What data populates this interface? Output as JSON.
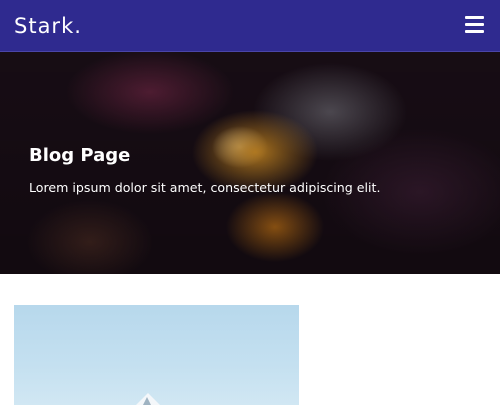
{
  "navbar": {
    "brand": "Stark.",
    "menu_icon": "hamburger-menu-icon",
    "background_color": "#2f2a8f"
  },
  "hero": {
    "title": "Blog Page",
    "subtitle": "Lorem ipsum dolor sit amet, consectetur adipiscing elit."
  },
  "posts": [
    {
      "image": "snowy-mountain-peak-image"
    }
  ]
}
